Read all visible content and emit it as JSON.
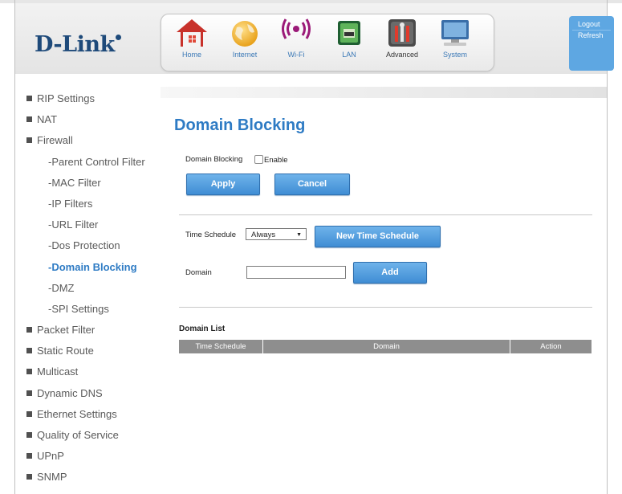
{
  "brand": {
    "logo": "D-Link"
  },
  "nav": [
    {
      "label": "Home",
      "icon": "home-icon"
    },
    {
      "label": "Internet",
      "icon": "globe-icon"
    },
    {
      "label": "Wi-Fi",
      "icon": "wifi-icon"
    },
    {
      "label": "LAN",
      "icon": "lan-port-icon"
    },
    {
      "label": "Advanced",
      "icon": "tools-icon"
    },
    {
      "label": "System",
      "icon": "monitor-icon"
    }
  ],
  "nav_active": "Advanced",
  "account": {
    "logout": "Logout",
    "refresh": "Refresh"
  },
  "sidebar": [
    {
      "label": "RIP Settings"
    },
    {
      "label": "NAT"
    },
    {
      "label": "Firewall"
    },
    {
      "label": "-Parent Control Filter"
    },
    {
      "label": "-MAC Filter"
    },
    {
      "label": "-IP Filters"
    },
    {
      "label": "-URL Filter"
    },
    {
      "label": "-Dos Protection"
    },
    {
      "label": "-Domain Blocking"
    },
    {
      "label": "-DMZ"
    },
    {
      "label": "-SPI Settings"
    },
    {
      "label": "Packet Filter"
    },
    {
      "label": "Static Route"
    },
    {
      "label": "Multicast"
    },
    {
      "label": "Dynamic DNS"
    },
    {
      "label": "Ethernet Settings"
    },
    {
      "label": "Quality of Service"
    },
    {
      "label": "UPnP"
    },
    {
      "label": "SNMP"
    }
  ],
  "page": {
    "title": "Domain Blocking",
    "domain_blocking_label": "Domain Blocking",
    "enable_label": "Enable",
    "enable_checked": false,
    "apply_label": "Apply",
    "cancel_label": "Cancel",
    "time_schedule_label": "Time Schedule",
    "time_schedule_value": "Always",
    "new_schedule_label": "New Time Schedule",
    "domain_label": "Domain",
    "domain_value": "",
    "add_label": "Add",
    "list_title": "Domain List",
    "columns": [
      "Time Schedule",
      "Domain",
      "Action"
    ],
    "rows": []
  },
  "colors": {
    "accent": "#2e7bc4",
    "button": "#4a98dc",
    "account_panel": "#5ea7e2",
    "table_header": "#8e8e8e"
  }
}
